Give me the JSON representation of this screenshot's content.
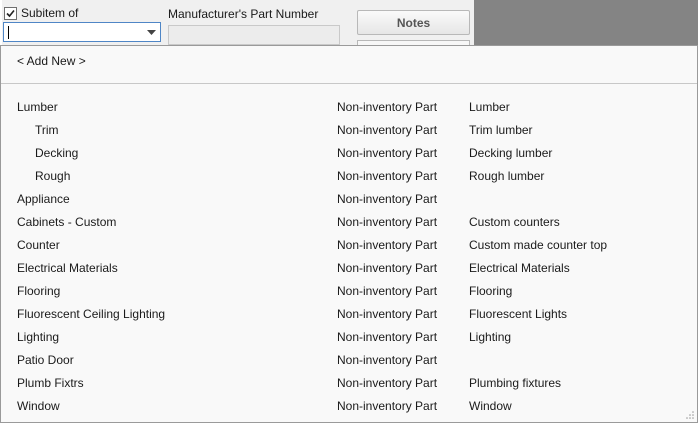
{
  "form": {
    "subitem_label": "Subitem of",
    "subitem_checked": true,
    "subitem_value": "",
    "mpn_label": "Manufacturer's Part Number",
    "mpn_value": "",
    "notes_label": "Notes"
  },
  "dropdown": {
    "add_new": "< Add New >",
    "items": [
      {
        "name": "Lumber",
        "type": "Non-inventory Part",
        "description": "Lumber",
        "indent": 0
      },
      {
        "name": "Trim",
        "type": "Non-inventory Part",
        "description": "Trim lumber",
        "indent": 1
      },
      {
        "name": "Decking",
        "type": "Non-inventory Part",
        "description": "Decking lumber",
        "indent": 1
      },
      {
        "name": "Rough",
        "type": "Non-inventory Part",
        "description": "Rough lumber",
        "indent": 1
      },
      {
        "name": "Appliance",
        "type": "Non-inventory Part",
        "description": "",
        "indent": 0
      },
      {
        "name": "Cabinets - Custom",
        "type": "Non-inventory Part",
        "description": "Custom counters",
        "indent": 0
      },
      {
        "name": "Counter",
        "type": "Non-inventory Part",
        "description": "Custom made counter top",
        "indent": 0
      },
      {
        "name": "Electrical Materials",
        "type": "Non-inventory Part",
        "description": "Electrical Materials",
        "indent": 0
      },
      {
        "name": "Flooring",
        "type": "Non-inventory Part",
        "description": "Flooring",
        "indent": 0
      },
      {
        "name": "Fluorescent Ceiling Lighting",
        "type": "Non-inventory Part",
        "description": "Fluorescent Lights",
        "indent": 0
      },
      {
        "name": "Lighting",
        "type": "Non-inventory Part",
        "description": "Lighting",
        "indent": 0
      },
      {
        "name": "Patio Door",
        "type": "Non-inventory Part",
        "description": "",
        "indent": 0
      },
      {
        "name": "Plumb Fixtrs",
        "type": "Non-inventory Part",
        "description": "Plumbing fixtures",
        "indent": 0
      },
      {
        "name": "Window",
        "type": "Non-inventory Part",
        "description": "Window",
        "indent": 0
      }
    ]
  },
  "icons": {
    "checkbox": "checkmark-icon",
    "combo_arrow": "chevron-down-icon",
    "resize": "resize-grip-icon"
  },
  "colors": {
    "focus_border": "#4f86c6",
    "background_gray": "#848484"
  }
}
